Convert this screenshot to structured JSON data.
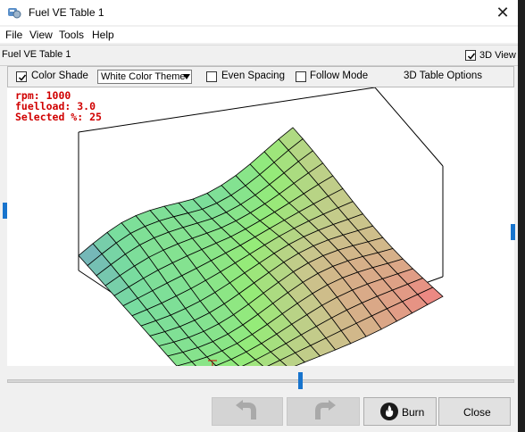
{
  "window": {
    "title": "Fuel VE Table 1"
  },
  "menu": [
    "File",
    "View",
    "Tools",
    "Help"
  ],
  "tab": {
    "label": "Fuel VE Table 1",
    "view3d_label": "3D View",
    "view3d_checked": true
  },
  "toolbar": {
    "color_shade_label": "Color Shade",
    "color_shade_checked": true,
    "theme_value": "White Color Theme",
    "even_spacing_label": "Even Spacing",
    "even_spacing_checked": false,
    "follow_mode_label": "Follow Mode",
    "follow_mode_checked": false,
    "options_label": "3D Table Options"
  },
  "plot_info": {
    "rpm": "rpm: 1000",
    "fuelload": "fuelload: 3.0",
    "selected": "Selected %: 25"
  },
  "selected_cell_value": "25",
  "buttons": {
    "undo_icon": "undo-icon",
    "redo_icon": "redo-icon",
    "burn": "Burn",
    "close": "Close"
  },
  "colors": {
    "accent": "#1874cd",
    "info_text": "#d00000"
  }
}
